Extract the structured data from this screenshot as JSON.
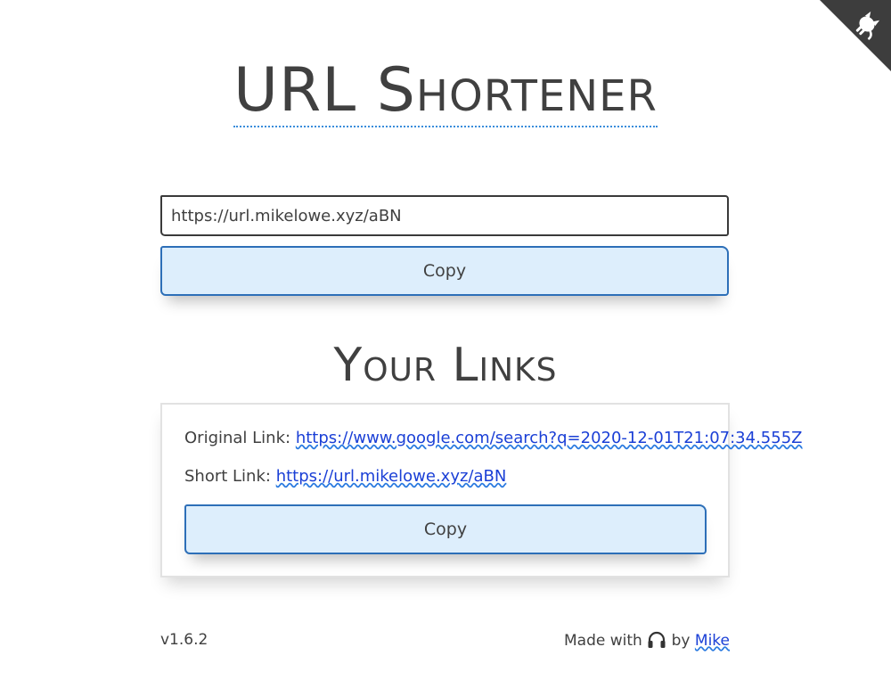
{
  "app": {
    "title": "URL Shortener"
  },
  "shortener": {
    "input_value": "https://url.mikelowe.xyz/aBN",
    "copy_label": "Copy"
  },
  "links": {
    "section_title": "Your Links",
    "original_label": "Original Link:",
    "original_url": "https://www.google.com/search?q=2020-12-01T21:07:34.555Z",
    "short_label": "Short Link:",
    "short_url": "https://url.mikelowe.xyz/aBN",
    "copy_label": "Copy"
  },
  "footer": {
    "version": "v1.6.2",
    "made_with": "Made with",
    "by": "by",
    "author": "Mike",
    "icon": "headphones-icon"
  },
  "corner": {
    "icon": "github-cat-icon"
  },
  "colors": {
    "accent": "#2d6fb8",
    "button_bg": "#ddeefc",
    "link": "#1a3fd6",
    "text": "#404040"
  }
}
